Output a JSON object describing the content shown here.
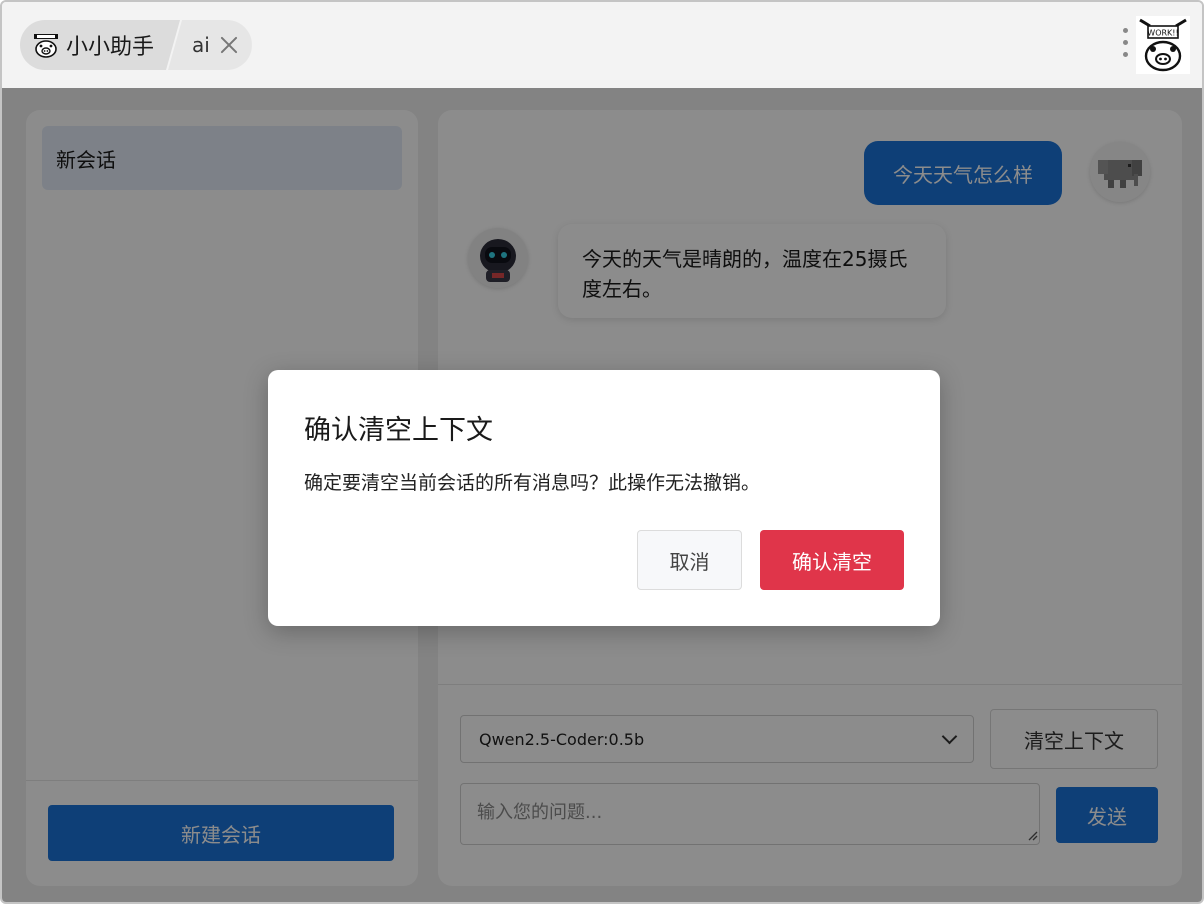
{
  "titlebar": {
    "app_name": "小小助手",
    "app_logo_icon": "pig-logo-icon",
    "tab_label": "ai",
    "close_icon": "close-icon",
    "menu_icon": "kebab-menu-icon",
    "mascot_icon": "work-mascot-icon",
    "mascot_text": "WORK!!"
  },
  "sidebar": {
    "sessions": [
      {
        "title": "新会话",
        "active": true
      }
    ],
    "new_session_label": "新建会话"
  },
  "chat": {
    "messages": [
      {
        "role": "user",
        "text": "今天天气怎么样",
        "avatar_icon": "elephant-avatar-icon"
      },
      {
        "role": "assistant",
        "text": "今天的天气是晴朗的，温度在25摄氏度左右。",
        "avatar_icon": "robot-avatar-icon"
      }
    ],
    "model_select": {
      "value": "Qwen2.5-Coder:0.5b"
    },
    "clear_context_label": "清空上下文",
    "input": {
      "placeholder": "输入您的问题...",
      "value": ""
    },
    "send_label": "发送"
  },
  "dialog": {
    "title": "确认清空上下文",
    "message": "确定要清空当前会话的所有消息吗？此操作无法撤销。",
    "cancel_label": "取消",
    "confirm_label": "确认清空"
  },
  "colors": {
    "primary": "#1a73d9",
    "danger": "#e0354a",
    "active_session_bg": "#e4ecf7",
    "overlay": "rgba(0,0,0,0.45)"
  }
}
